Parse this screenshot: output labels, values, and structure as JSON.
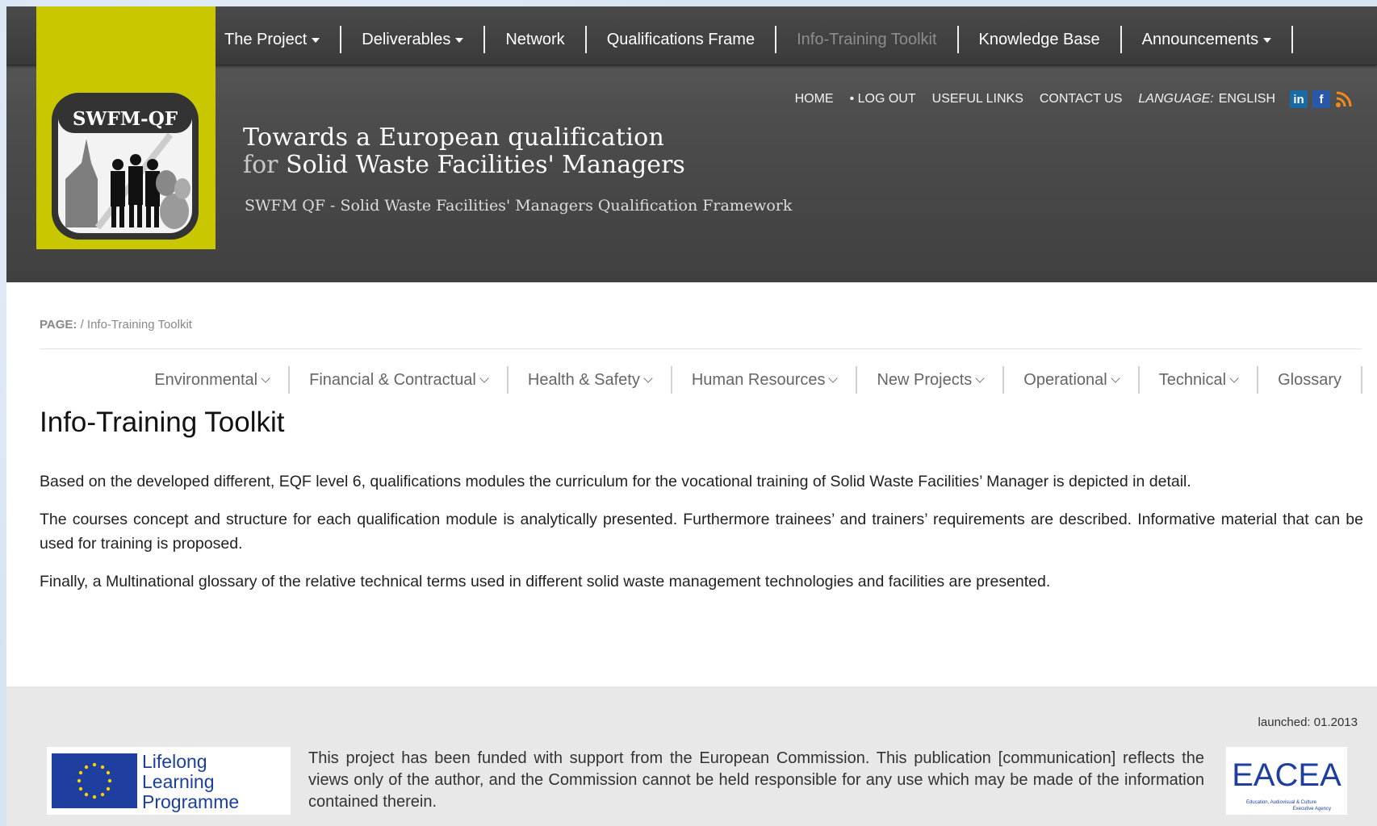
{
  "top_nav": {
    "items": [
      {
        "label": "The Project",
        "dropdown": true
      },
      {
        "label": "Deliverables",
        "dropdown": true
      },
      {
        "label": "Network",
        "dropdown": false
      },
      {
        "label": "Qualifications Frame",
        "dropdown": false
      },
      {
        "label": "Info-Training Toolkit",
        "dropdown": false,
        "active": true
      },
      {
        "label": "Knowledge Base",
        "dropdown": false
      },
      {
        "label": "Announcements",
        "dropdown": true
      }
    ]
  },
  "logo": {
    "text": "SWFM-QF"
  },
  "utility": {
    "home": "HOME",
    "logout": "• LOG OUT",
    "useful_links": "USEFUL LINKS",
    "contact": "CONTACT US",
    "language_label": "LANGUAGE:",
    "language_value": "ENGLISH",
    "social": [
      "linkedin-icon",
      "facebook-icon",
      "rss-icon"
    ]
  },
  "header": {
    "tagline_line1": "Towards a European qualification",
    "tagline_line2_prefix": "for",
    "tagline_line2_rest": "Solid Waste Facilities' Managers",
    "subtitle": "SWFM QF - Solid Waste Facilities' Managers Qualification Framework"
  },
  "breadcrumb": {
    "label": "PAGE:",
    "path": "/ Info-Training Toolkit"
  },
  "sub_nav": {
    "items": [
      {
        "label": "Environmental",
        "dropdown": true
      },
      {
        "label": "Financial & Contractual",
        "dropdown": true
      },
      {
        "label": "Health & Safety",
        "dropdown": true
      },
      {
        "label": "Human Resources",
        "dropdown": true
      },
      {
        "label": "New Projects",
        "dropdown": true
      },
      {
        "label": "Operational",
        "dropdown": true
      },
      {
        "label": "Technical",
        "dropdown": true
      },
      {
        "label": "Glossary",
        "dropdown": false
      }
    ]
  },
  "content": {
    "title": "Info-Training Toolkit",
    "paragraphs": [
      "Based on the developed different, EQF level 6, qualifications modules the curriculum for the vocational training of Solid Waste Facilities’ Manager is depicted in detail.",
      "The courses concept and structure for each qualification module is analytically presented. Furthermore trainees’ and trainers’ requirements are described. Informative material that can be used for training is proposed.",
      "Finally, a Multinational glossary of the relative technical terms used in different solid waste management technologies and facilities are presented."
    ]
  },
  "footer": {
    "launched": "launched: 01.2013",
    "llp_line1": "Lifelong",
    "llp_line2": "Learning",
    "llp_line3": "Programme",
    "disclaimer": "This project has been funded with support from the European Commission. This publication [communication] reflects the views only of the author, and the Commission cannot be held responsible for any use which may be made of the information contained therein.",
    "eacea_text": "EACEA",
    "eacea_sub1": "Education, Audiovisual & Culture",
    "eacea_sub2": "Executive Agency"
  },
  "colors": {
    "header_dark": "#4d4d4d",
    "logo_yellow": "#c9c800",
    "eu_blue": "#1f3fa0",
    "text_dark": "#222222"
  }
}
